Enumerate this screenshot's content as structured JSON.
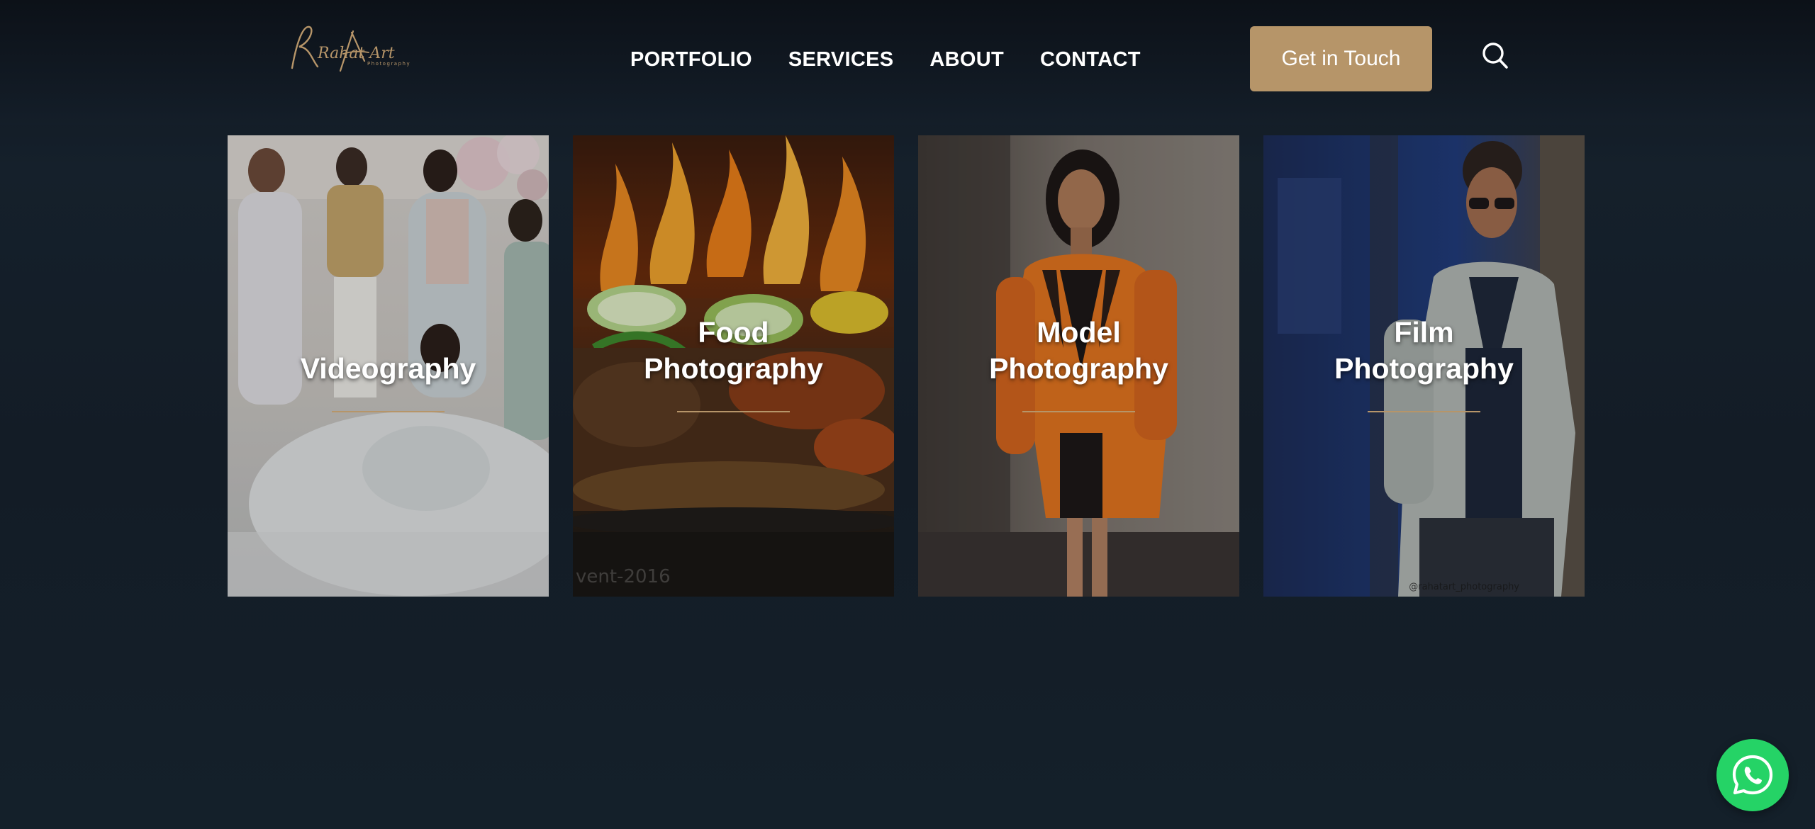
{
  "header": {
    "logo_alt": "Rahat Art Photography",
    "logo_script": "Rahat Art",
    "logo_small": "Photography",
    "nav": [
      {
        "label": "PORTFOLIO"
      },
      {
        "label": "SERVICES"
      },
      {
        "label": "ABOUT"
      },
      {
        "label": "CONTACT"
      }
    ],
    "cta_label": "Get in Touch",
    "search_icon": "search-icon"
  },
  "cards": [
    {
      "line1": "Videography",
      "line2": ""
    },
    {
      "line1": "Food",
      "line2": "Photography",
      "watermark": "vent-2016"
    },
    {
      "line1": "Model",
      "line2": "Photography"
    },
    {
      "line1": "Film",
      "line2": "Photography",
      "credit": "@rahatart_photography"
    }
  ],
  "colors": {
    "accent": "#b69569",
    "background": "#131c26",
    "whatsapp": "#25d366"
  },
  "floating": {
    "whatsapp_icon": "whatsapp-icon"
  }
}
